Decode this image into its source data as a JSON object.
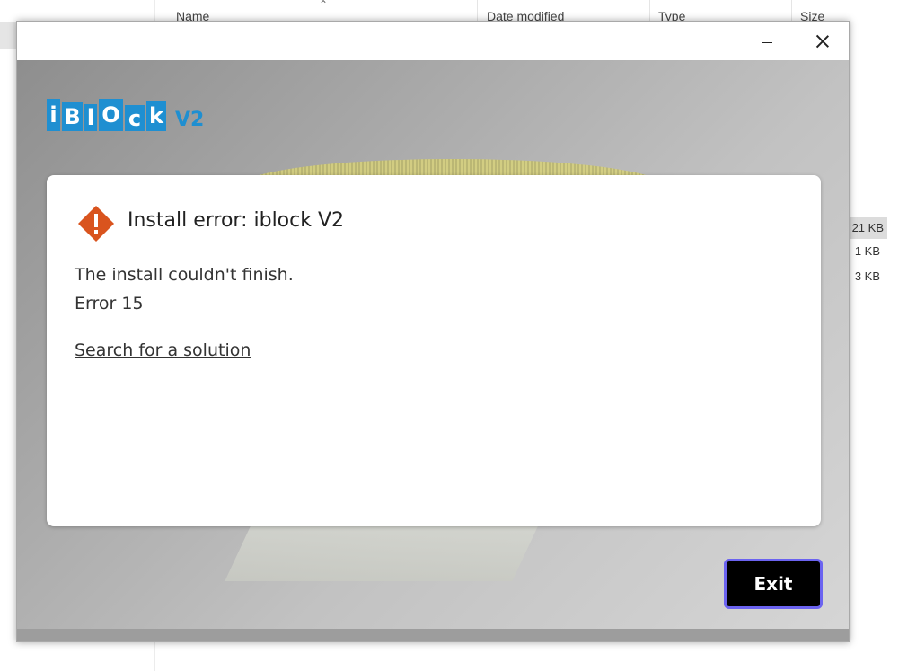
{
  "explorer": {
    "columns": [
      "Name",
      "Date modified",
      "Type",
      "Size"
    ],
    "sizes": [
      "21 KB",
      "1 KB",
      "3 KB"
    ]
  },
  "window": {
    "controls": [
      "minimize",
      "close"
    ]
  },
  "logo": {
    "letters": [
      "i",
      "B",
      "l",
      "O",
      "c",
      "k"
    ],
    "version": "V2",
    "color": "#1f8fd1"
  },
  "dialog": {
    "icon": "warning-diamond-icon",
    "icon_color": "#d9541e",
    "title": "Install error: iblock V2",
    "message": "The install couldn't finish.",
    "error_code": "Error 15",
    "link": "Search for a solution"
  },
  "actions": {
    "exit_label": "Exit",
    "focus_color": "#6b63f0"
  }
}
